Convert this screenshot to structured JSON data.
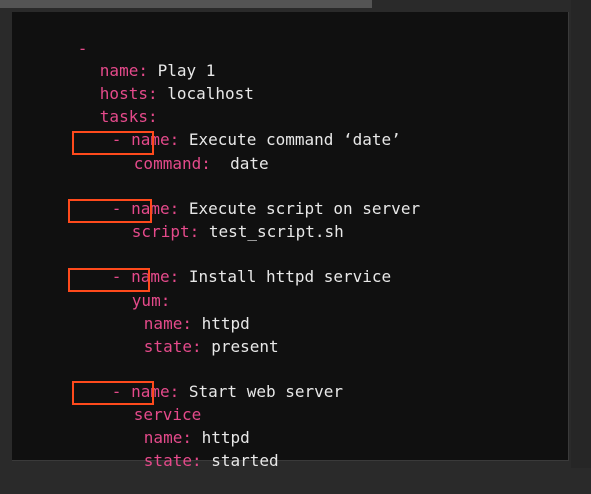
{
  "editor": {
    "root_dash": "-",
    "play_name_key": "name:",
    "play_name_value": "Play 1",
    "hosts_key": "hosts:",
    "hosts_value": "localhost",
    "tasks_key": "tasks:",
    "tasks": [
      {
        "dash": "-",
        "name_key": "name:",
        "name_value": "Execute command ‘date’",
        "module_key": "command:",
        "module_value": "date"
      },
      {
        "dash": "-",
        "name_key": "name:",
        "name_value": "Execute script on server",
        "module_key": "script:",
        "module_value": "test_script.sh"
      },
      {
        "dash": "-",
        "name_key": "name:",
        "name_value": "Install httpd service",
        "module_key": "yum:",
        "sub": [
          {
            "key": "name:",
            "value": "httpd"
          },
          {
            "key": "state:",
            "value": "present"
          }
        ]
      },
      {
        "dash": "-",
        "name_key": "name:",
        "name_value": "Start web server",
        "module_key": "service",
        "sub": [
          {
            "key": "name:",
            "value": "httpd"
          },
          {
            "key": "state:",
            "value": "started"
          }
        ]
      }
    ]
  },
  "colors": {
    "key": "#e54a8b",
    "value": "#e8e8e8",
    "highlight_box": "#ff4a1c",
    "background": "#101010"
  }
}
